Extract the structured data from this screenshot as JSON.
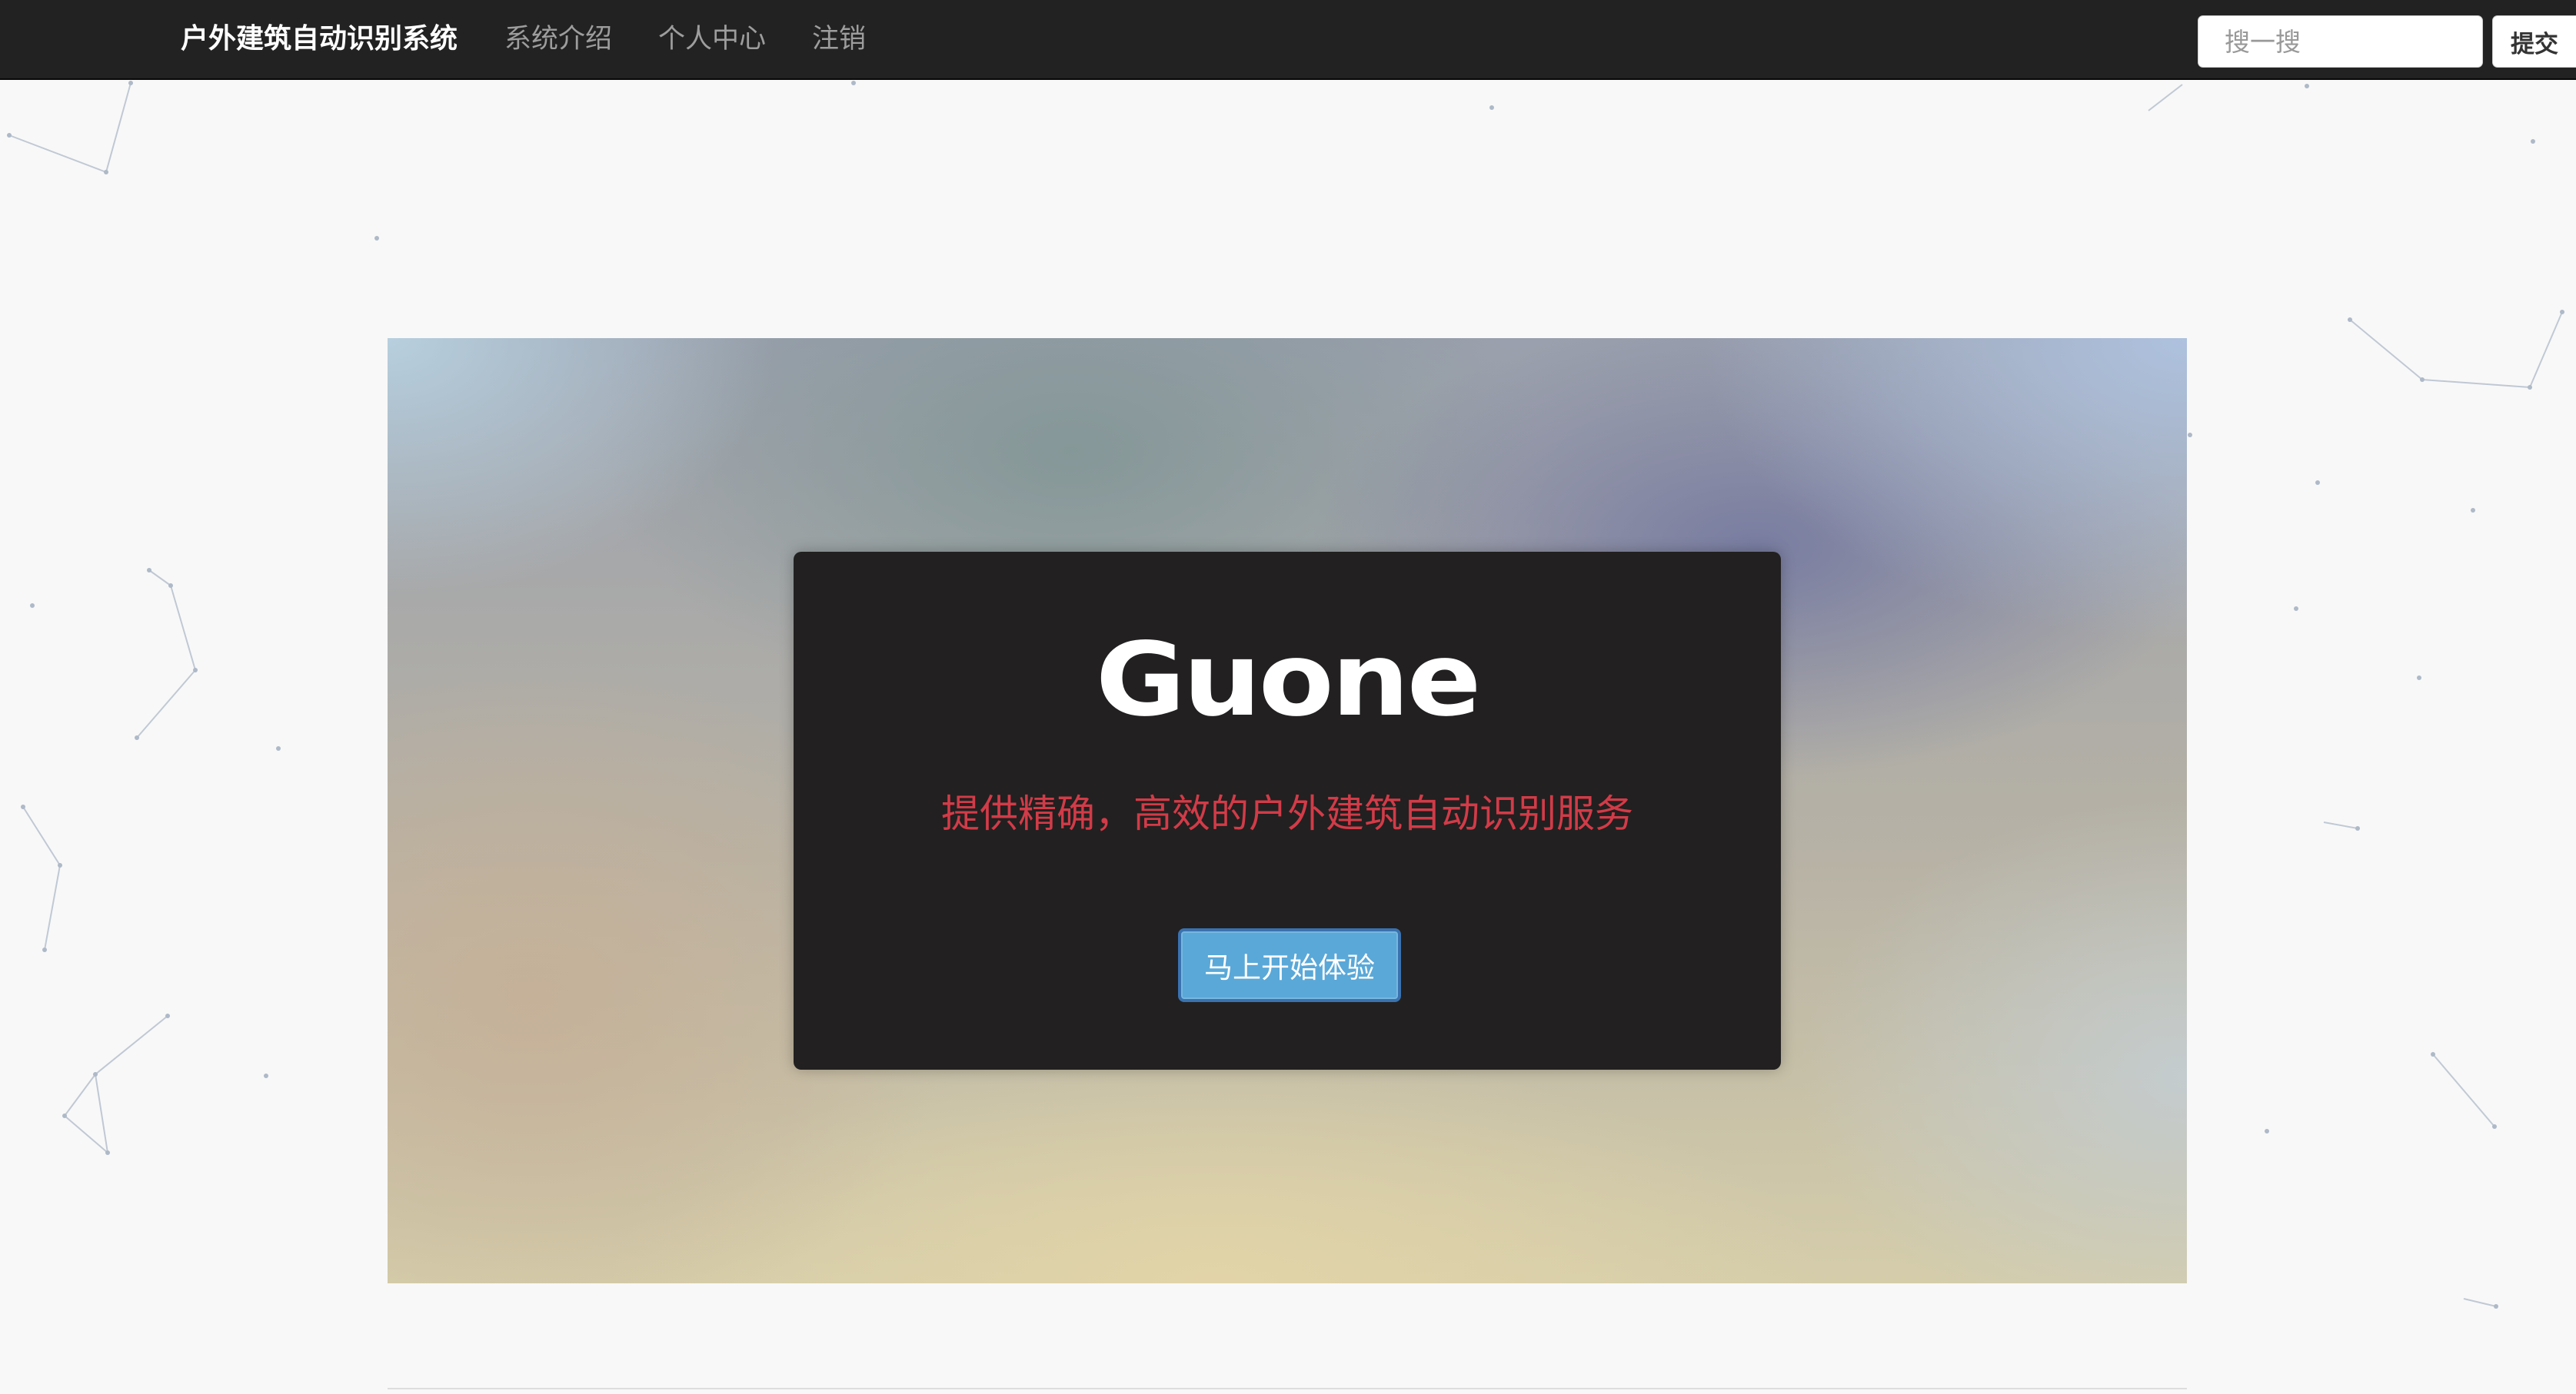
{
  "navbar": {
    "brand": "户外建筑自动识别系统",
    "links": [
      {
        "label": "系统介绍"
      },
      {
        "label": "个人中心"
      },
      {
        "label": "注销"
      }
    ],
    "search": {
      "placeholder": "搜一搜",
      "value": ""
    },
    "submit_label": "提交"
  },
  "hero": {
    "title": "Guone",
    "subtitle": "提供精确，高效的户外建筑自动识别服务",
    "button_label": "马上开始体验"
  },
  "colors": {
    "navbar_bg": "#222222",
    "nav_link": "#9d9d9d",
    "card_bg": "#222020",
    "subtitle": "#d23b48",
    "button": "#5aa8d8",
    "page_bg": "#f8f8f8"
  }
}
